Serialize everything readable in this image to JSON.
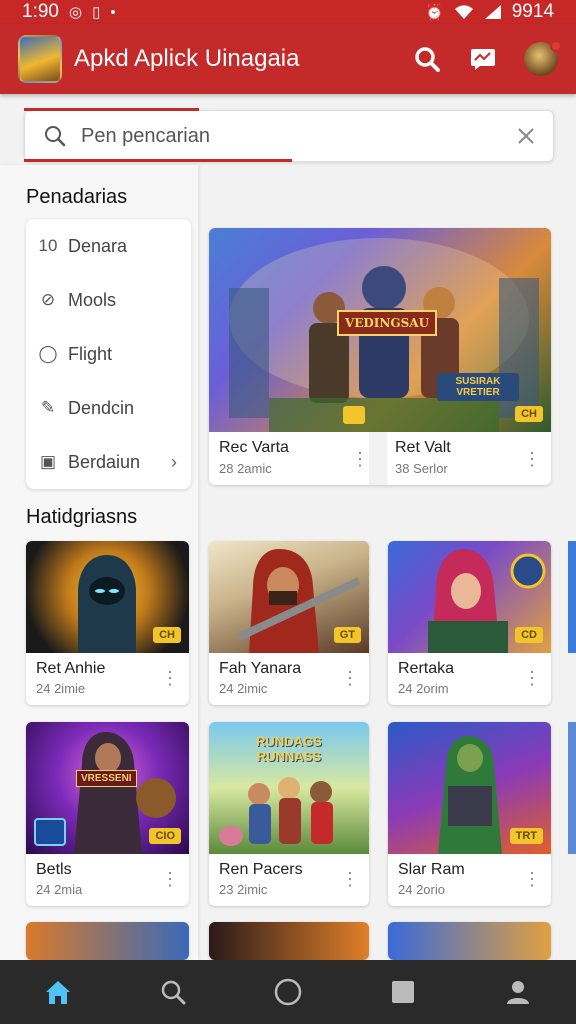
{
  "status": {
    "time": "1:90",
    "battery": "9914"
  },
  "app": {
    "title": "Apkd Aplick Uinagaia"
  },
  "search": {
    "placeholder": "Pen  pencarian"
  },
  "sidebar": {
    "heading": "Penadarias",
    "items": [
      {
        "label": "Denara",
        "icon": "number-icon",
        "glyph": "10"
      },
      {
        "label": "Mools",
        "icon": "leaf-icon",
        "glyph": "⊘"
      },
      {
        "label": "Flight",
        "icon": "shield-icon",
        "glyph": "◯"
      },
      {
        "label": "Dendcin",
        "icon": "pencil-icon",
        "glyph": "✎"
      },
      {
        "label": "Berdaiun",
        "icon": "edit-box-icon",
        "glyph": "▣"
      }
    ],
    "section2": "Hatidgriasns"
  },
  "featured": [
    {
      "title": "Rec Varta",
      "sub": "28 2amic",
      "badge": "CH",
      "banner": "VEDINGSAU",
      "logo": "SUSIRAK VRETIER"
    },
    {
      "title": "Ret Valt",
      "sub": "38 Serlor"
    }
  ],
  "games": [
    {
      "title": "Ret Anhie",
      "sub": "24 2imie",
      "badge": "CH"
    },
    {
      "title": "Fah Yanara",
      "sub": "24 2imic",
      "badge": "GT"
    },
    {
      "title": "Rertaka",
      "sub": "24 2orim",
      "badge": "CD"
    },
    {
      "title": "Betls",
      "sub": "24 2mia",
      "badge": "CIO",
      "banner": "VRESSENI"
    },
    {
      "title": "Ren Pacers",
      "sub": "23 2imic",
      "banner": "RUNDAGS RUNNASS"
    },
    {
      "title": "Slar Ram",
      "sub": "24 2orio",
      "badge": "TRT"
    }
  ],
  "colors": {
    "accent": "#c42a2a",
    "badge": "#f2c62a",
    "nav_active": "#4fc3f7"
  }
}
